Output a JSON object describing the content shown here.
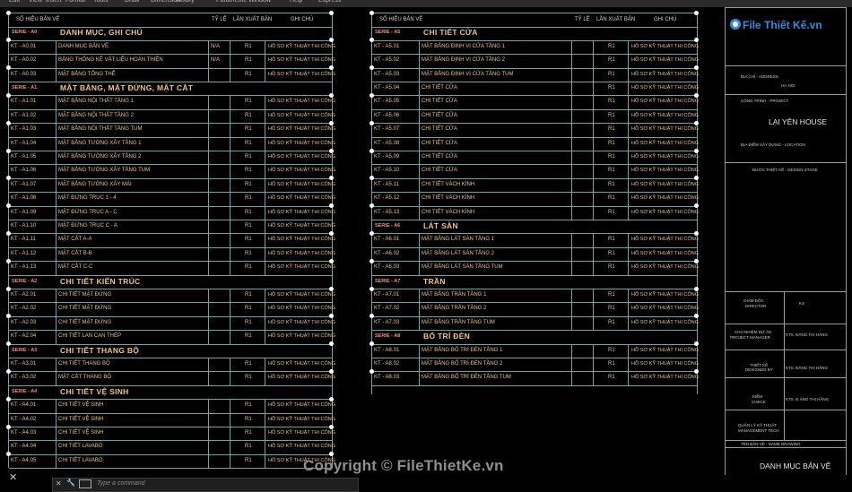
{
  "menu": [
    "Edit",
    "View",
    "Insert",
    "Format",
    "Tools",
    "Draw",
    "Dimension",
    "Modify",
    "Parametric",
    "Window",
    "Help",
    "Express"
  ],
  "header": {
    "code": "SỐ HIỆU BẢN VẼ",
    "title": "",
    "scale": "TỶ LỆ",
    "rev": "LẦN XUẤT BẢN",
    "note": "GHI CHÚ"
  },
  "left_table": [
    {
      "sec": "SERIE - A0",
      "title": "DANH MỤC, GHI CHÚ"
    },
    {
      "code": "KT - A0.01",
      "title": "DANH MỤC BẢN VẼ",
      "scale": "N/A",
      "rev": "R1",
      "note": "HỒ SƠ KỸ THUẬT THI CÔNG"
    },
    {
      "code": "KT - A0.02",
      "title": "BẢNG THỐNG KÊ VẬT LIỆU HOÀN THIỆN",
      "scale": "N/A",
      "rev": "R1",
      "note": "HỒ SƠ KỸ THUẬT THI CÔNG"
    },
    {
      "code": "KT - A0.03",
      "title": "MẶT BẰNG TỔNG THỂ",
      "scale": "",
      "rev": "R1",
      "note": "HỒ SƠ KỸ THUẬT THI CÔNG"
    },
    {
      "sec": "SERIE - A1",
      "title": "MẶT BẰNG, MẶT ĐỨNG, MẶT CẮT"
    },
    {
      "code": "KT - A1.01",
      "title": "MẶT BẰNG NỘI THẤT TẦNG 1",
      "scale": "",
      "rev": "R1",
      "note": "HỒ SƠ KỸ THUẬT THI CÔNG"
    },
    {
      "code": "KT - A1.02",
      "title": "MẶT BẰNG NỘI THẤT TẦNG 2",
      "scale": "",
      "rev": "R1",
      "note": "HỒ SƠ KỸ THUẬT THI CÔNG"
    },
    {
      "code": "KT - A1.03",
      "title": "MẶT BẰNG NỘI THẤT TẦNG TUM",
      "scale": "",
      "rev": "R1",
      "note": "HỒ SƠ KỸ THUẬT THI CÔNG"
    },
    {
      "code": "KT - A1.04",
      "title": "MẶT BẰNG TƯỜNG XÂY TẦNG 1",
      "scale": "",
      "rev": "R1",
      "note": "HỒ SƠ KỸ THUẬT THI CÔNG"
    },
    {
      "code": "KT - A1.05",
      "title": "MẶT BẰNG TƯỜNG XÂY TẦNG 2",
      "scale": "",
      "rev": "R1",
      "note": "HỒ SƠ KỸ THUẬT THI CÔNG"
    },
    {
      "code": "KT - A1.06",
      "title": "MẶT BẰNG TƯỜNG XÂY TẦNG TUM",
      "scale": "",
      "rev": "R1",
      "note": "HỒ SƠ KỸ THUẬT THI CÔNG"
    },
    {
      "code": "KT - A1.07",
      "title": "MẶT BẰNG TƯỜNG XÂY MÁI",
      "scale": "",
      "rev": "R1",
      "note": "HỒ SƠ KỸ THUẬT THI CÔNG"
    },
    {
      "code": "KT - A1.08",
      "title": "MẶT ĐỨNG TRỤC 1 - 4",
      "scale": "",
      "rev": "R1",
      "note": "HỒ SƠ KỸ THUẬT THI CÔNG"
    },
    {
      "code": "KT - A1.09",
      "title": "MẶT ĐỨNG TRỤC A - C",
      "scale": "",
      "rev": "R1",
      "note": "HỒ SƠ KỸ THUẬT THI CÔNG"
    },
    {
      "code": "KT - A1.10",
      "title": "MẶT ĐỨNG TRỤC C - A",
      "scale": "",
      "rev": "R1",
      "note": "HỒ SƠ KỸ THUẬT THI CÔNG"
    },
    {
      "code": "KT - A1.11",
      "title": "MẶT CẮT A-A",
      "scale": "",
      "rev": "R1",
      "note": "HỒ SƠ KỸ THUẬT THI CÔNG"
    },
    {
      "code": "KT - A1.12",
      "title": "MẶT CẮT B-B",
      "scale": "",
      "rev": "R1",
      "note": "HỒ SƠ KỸ THUẬT THI CÔNG"
    },
    {
      "code": "KT - A1.13",
      "title": "MẶT CẮT C-C",
      "scale": "",
      "rev": "R1",
      "note": "HỒ SƠ KỸ THUẬT THI CÔNG"
    },
    {
      "sec": "SERIE - A2",
      "title": "CHI TIẾT KIẾN TRÚC"
    },
    {
      "code": "KT - A2.01",
      "title": "CHI TIẾT MẶT ĐỨNG",
      "scale": "",
      "rev": "R1",
      "note": "HỒ SƠ KỸ THUẬT THI CÔNG"
    },
    {
      "code": "KT - A2.02",
      "title": "CHI TIẾT MẶT ĐỨNG",
      "scale": "",
      "rev": "R1",
      "note": "HỒ SƠ KỸ THUẬT THI CÔNG"
    },
    {
      "code": "KT - A2.03",
      "title": "CHI TIẾT MẶT ĐỨNG",
      "scale": "",
      "rev": "R1",
      "note": "HỒ SƠ KỸ THUẬT THI CÔNG"
    },
    {
      "code": "KT - A2.04",
      "title": "CHI TIẾT LAN CAN THÉP",
      "scale": "",
      "rev": "R1",
      "note": "HỒ SƠ KỸ THUẬT THI CÔNG"
    },
    {
      "sec": "SERIE - A3",
      "title": "CHI TIẾT THANG BỘ"
    },
    {
      "code": "KT - A3.01",
      "title": "CHI TIẾT THANG BỘ",
      "scale": "",
      "rev": "R1",
      "note": "HỒ SƠ KỸ THUẬT THI CÔNG"
    },
    {
      "code": "KT - A3.02",
      "title": "MẶT CẮT THANG BỘ",
      "scale": "",
      "rev": "R1",
      "note": "HỒ SƠ KỸ THUẬT THI CÔNG"
    },
    {
      "sec": "SERIE - A4",
      "title": "CHI TIẾT VỆ SINH"
    },
    {
      "code": "KT - A4.01",
      "title": "CHI TIẾT VỆ SINH",
      "scale": "",
      "rev": "R1",
      "note": "HỒ SƠ KỸ THUẬT THI CÔNG"
    },
    {
      "code": "KT - A4.02",
      "title": "CHI TIẾT VỆ SINH",
      "scale": "",
      "rev": "R1",
      "note": "HỒ SƠ KỸ THUẬT THI CÔNG"
    },
    {
      "code": "KT - A4.03",
      "title": "CHI TIẾT VỆ SINH",
      "scale": "",
      "rev": "R1",
      "note": "HỒ SƠ KỸ THUẬT THI CÔNG"
    },
    {
      "code": "KT - A4.04",
      "title": "CHI TIẾT LAVABO",
      "scale": "",
      "rev": "R1",
      "note": "HỒ SƠ KỸ THUẬT THI CÔNG"
    },
    {
      "code": "KT - A4.05",
      "title": "CHI TIẾT LAVABO",
      "scale": "",
      "rev": "R1",
      "note": "HỒ SƠ KỸ THUẬT THI CÔNG"
    }
  ],
  "right_table": [
    {
      "sec": "SERIE - A5",
      "title": "CHI TIẾT CỬA"
    },
    {
      "code": "KT - A5.01",
      "title": "MẶT BẰNG ĐỊNH VỊ CỬA TẦNG 1",
      "scale": "",
      "rev": "R1",
      "note": "HỒ SƠ KỸ THUẬT THI CÔNG"
    },
    {
      "code": "KT - A5.02",
      "title": "MẶT BẰNG ĐỊNH VỊ CỬA TẦNG 2",
      "scale": "",
      "rev": "R1",
      "note": "HỒ SƠ KỸ THUẬT THI CÔNG"
    },
    {
      "code": "KT - A5.03",
      "title": "MẶT BẰNG ĐỊNH VỊ CỬA TẦNG TUM",
      "scale": "",
      "rev": "R1",
      "note": "HỒ SƠ KỸ THUẬT THI CÔNG"
    },
    {
      "code": "KT - A5.04",
      "title": "CHI TIẾT CỬA",
      "scale": "",
      "rev": "R1",
      "note": "HỒ SƠ KỸ THUẬT THI CÔNG"
    },
    {
      "code": "KT - A5.05",
      "title": "CHI TIẾT CỬA",
      "scale": "",
      "rev": "R1",
      "note": "HỒ SƠ KỸ THUẬT THI CÔNG"
    },
    {
      "code": "KT - A5.06",
      "title": "CHI TIẾT CỬA",
      "scale": "",
      "rev": "R1",
      "note": "HỒ SƠ KỸ THUẬT THI CÔNG"
    },
    {
      "code": "KT - A5.07",
      "title": "CHI TIẾT CỬA",
      "scale": "",
      "rev": "R1",
      "note": "HỒ SƠ KỸ THUẬT THI CÔNG"
    },
    {
      "code": "KT - A5.08",
      "title": "CHI TIẾT CỬA",
      "scale": "",
      "rev": "R1",
      "note": "HỒ SƠ KỸ THUẬT THI CÔNG"
    },
    {
      "code": "KT - A5.09",
      "title": "CHI TIẾT CỬA",
      "scale": "",
      "rev": "R1",
      "note": "HỒ SƠ KỸ THUẬT THI CÔNG"
    },
    {
      "code": "KT - A5.10",
      "title": "CHI TIẾT CỬA",
      "scale": "",
      "rev": "R1",
      "note": "HỒ SƠ KỸ THUẬT THI CÔNG"
    },
    {
      "code": "KT - A5.11",
      "title": "CHI TIẾT VÁCH KÍNH",
      "scale": "",
      "rev": "R1",
      "note": "HỒ SƠ KỸ THUẬT THI CÔNG"
    },
    {
      "code": "KT - A5.12",
      "title": "CHI TIẾT VÁCH KÍNH",
      "scale": "",
      "rev": "R1",
      "note": "HỒ SƠ KỸ THUẬT THI CÔNG"
    },
    {
      "code": "KT - A5.13",
      "title": "CHI TIẾT VÁCH KÍNH",
      "scale": "",
      "rev": "R1",
      "note": "HỒ SƠ KỸ THUẬT THI CÔNG"
    },
    {
      "sec": "SERIE - A6",
      "title": "LÁT SÀN"
    },
    {
      "code": "KT - A6.01",
      "title": "MẶT BẰNG LÁT SÀN TẦNG 1",
      "scale": "",
      "rev": "R1",
      "note": "HỒ SƠ KỸ THUẬT THI CÔNG"
    },
    {
      "code": "KT - A6.02",
      "title": "MẶT BẰNG LÁT SÀN TẦNG 2",
      "scale": "",
      "rev": "R1",
      "note": "HỒ SƠ KỸ THUẬT THI CÔNG"
    },
    {
      "code": "KT - A6.03",
      "title": "MẶT BẰNG LÁT SÀN TẦNG TUM",
      "scale": "",
      "rev": "R1",
      "note": "HỒ SƠ KỸ THUẬT THI CÔNG"
    },
    {
      "sec": "SERIE - A7",
      "title": "TRẦN"
    },
    {
      "code": "KT - A7.01",
      "title": "MẶT BẰNG TRẦN TẦNG 1",
      "scale": "",
      "rev": "R1",
      "note": "HỒ SƠ KỸ THUẬT THI CÔNG"
    },
    {
      "code": "KT - A7.02",
      "title": "MẶT BẰNG TRẦN TẦNG 2",
      "scale": "",
      "rev": "R1",
      "note": "HỒ SƠ KỸ THUẬT THI CÔNG"
    },
    {
      "code": "KT - A7.03",
      "title": "MẶT BẰNG TRẦN TẦNG TUM",
      "scale": "",
      "rev": "R1",
      "note": "HỒ SƠ KỸ THUẬT THI CÔNG"
    },
    {
      "sec": "SERIE - A8",
      "title": "BỐ TRÍ ĐÈN"
    },
    {
      "code": "KT - A8.01",
      "title": "MẶT BẰNG BỐ TRÍ ĐÈN TẦNG 1",
      "scale": "",
      "rev": "R1",
      "note": "HỒ SƠ KỸ THUẬT THI CÔNG"
    },
    {
      "code": "KT - A8.02",
      "title": "MẶT BẰNG BỐ TRÍ ĐÈN TẦNG 2",
      "scale": "",
      "rev": "R1",
      "note": "HỒ SƠ KỸ THUẬT THI CÔNG"
    },
    {
      "code": "KT - A8.03",
      "title": "MẶT BẰNG BỐ TRÍ ĐÈN TẦNG TUM",
      "scale": "",
      "rev": "R1",
      "note": "HỒ SƠ KỸ THUẬT THI CÔNG"
    }
  ],
  "title_block": {
    "logo_text": "File Thiết Kế.vn",
    "address_label": "ĐỊA CHỈ - ADDRESS",
    "address": "HÀ NỘI",
    "project_label": "CÔNG TRÌNH - PROJECT",
    "project": "LẠI YÊN HOUSE",
    "location_label": "ĐỊA ĐIỂM XÂY DỰNG - LOCATION",
    "stage_label": "BƯỚC THIẾT KẾ - DESIGN STAGE",
    "director_label": "GIÁM ĐỐC",
    "director_label_en": "DIRECTOR",
    "director": "KS",
    "pm_label": "CHỦ NHIỆM DỰ ÁN",
    "pm_label_en": "PROJECT MANAGER",
    "pm": "KTS. ĐẶNG THỊ HẰNG",
    "designer_label": "THIẾT KẾ",
    "designer_label_en": "DESIGNED BY",
    "designer": "KTS. ĐẶNG THỊ HẰNG",
    "checker_label": "KIỂM",
    "checker_label_en": "CHECK",
    "checker": "KTS. Đ ẶNG THỊ HẰNG",
    "tech_label": "QUẢN LÝ KỸ THUẬT",
    "tech_label_en": "MANAGEMENT TECH",
    "drawing_name_label": "TÊN BẢN VẼ - NAME DRAWING",
    "drawing_name": "DANH MỤC BẢN VẼ"
  },
  "command": {
    "placeholder": "Type a command"
  },
  "watermark": "Copyright © FileThietKe.vn",
  "colors": {
    "line": "#6ea5a5",
    "text": "#e8c48c",
    "serie": "#f08a8a",
    "title": "#f2c27e"
  }
}
